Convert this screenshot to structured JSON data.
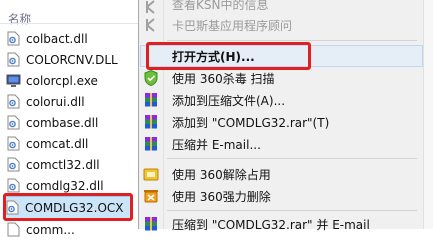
{
  "file_pane": {
    "column_header": "名称",
    "files": [
      {
        "name": "colbact.dll",
        "icon": "dll-icon"
      },
      {
        "name": "COLORCNV.DLL",
        "icon": "dll-icon"
      },
      {
        "name": "colorcpl.exe",
        "icon": "exe-icon"
      },
      {
        "name": "colorui.dll",
        "icon": "dll-icon"
      },
      {
        "name": "combase.dll",
        "icon": "dll-icon"
      },
      {
        "name": "comcat.dll",
        "icon": "dll-icon"
      },
      {
        "name": "comctl32.dll",
        "icon": "dll-icon"
      },
      {
        "name": "comdlg32.dll",
        "icon": "dll-icon"
      },
      {
        "name": "COMDLG32.OCX",
        "icon": "ocx-icon",
        "selected": true
      },
      {
        "name": "comm...",
        "icon": "dll-icon"
      }
    ]
  },
  "context_menu": {
    "items": [
      {
        "label": "查看KSN中的信息",
        "icon": "kaspersky-icon",
        "disabled": true
      },
      {
        "label": "卡巴斯基应用程序顾问",
        "icon": "kaspersky-icon",
        "disabled": true
      },
      {
        "label": "打开方式(H)...",
        "icon": "",
        "highlighted": true
      },
      {
        "label": "使用 360杀毒 扫描",
        "icon": "360-shield-icon"
      },
      {
        "label": "添加到压缩文件(A)...",
        "icon": "winrar-icon"
      },
      {
        "label": "添加到 \"COMDLG32.rar\"(T)",
        "icon": "winrar-icon"
      },
      {
        "label": "压缩并 E-mail...",
        "icon": "winrar-icon"
      },
      {
        "label": "使用 360解除占用",
        "icon": "360-unlock-icon"
      },
      {
        "label": "使用 360强力删除",
        "icon": "360-delete-icon"
      },
      {
        "label": "压缩到 \"COMDLG32.rar\" 并 E-mail",
        "icon": "winrar-icon"
      }
    ]
  },
  "colors": {
    "highlight_border": "#e02020",
    "selection_fill": "#cce4f7",
    "menu_bg": "#f0f0f0"
  }
}
